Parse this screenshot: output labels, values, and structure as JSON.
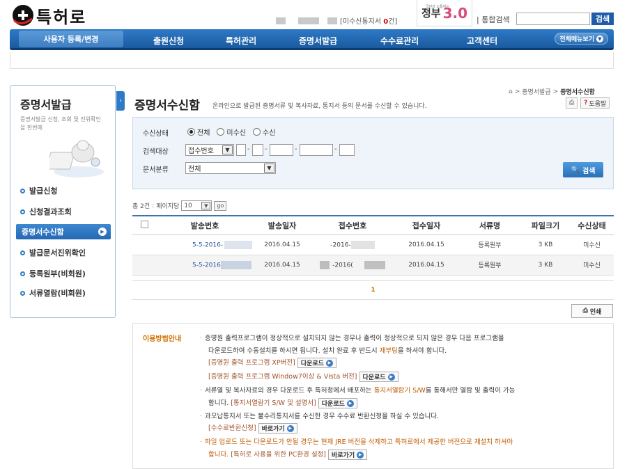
{
  "header": {
    "logo_text": "특허로",
    "unread_label_pre": "[미수신통지서 ",
    "unread_count": "0",
    "unread_label_post": "건]",
    "gov_brand": "정부",
    "gov_num": "3.0",
    "gov_small": "국민과 소통하는",
    "search_label": "| 통합검색",
    "search_button": "검색"
  },
  "gnb": {
    "first": "사용자 등록/변경",
    "items": [
      "출원신청",
      "특허관리",
      "증명서발급",
      "수수료관리",
      "고객센터"
    ],
    "all_menu": "전체메뉴보기"
  },
  "lnb": {
    "title": "증명서발급",
    "desc": "증명서발급 신청, 조회 및 진위확인을 한번에",
    "items": [
      "발급신청",
      "신청결과조회",
      "증명서수신함",
      "발급문서진위확인",
      "등록원부(비회원)",
      "서류열람(비회원)"
    ]
  },
  "content": {
    "title": "증명서수신함",
    "desc": "온라인으로 발급된 증명서류 및 복사자료, 통지서 등의 문서를 수신할 수 있습니다.",
    "breadcrumb_mid": "증명서발급",
    "breadcrumb_last": "증명서수신함",
    "help": "도움말"
  },
  "search": {
    "status_label": "수신상태",
    "status_options": [
      "전체",
      "미수신",
      "수신"
    ],
    "target_label": "검색대상",
    "target_value": "접수번호",
    "category_label": "문서분류",
    "category_value": "전체",
    "button": "검색"
  },
  "results": {
    "count_text": "총 2건",
    "per_page_label": "페이지당",
    "per_page": "10",
    "go": "go",
    "columns": [
      "발송번호",
      "발송일자",
      "접수번호",
      "접수일자",
      "서류명",
      "파일크기",
      "수신상태"
    ],
    "rows": [
      {
        "send_no": "5-5-2016-",
        "send_date": "2016.04.15",
        "recv_no": "-2016-",
        "recv_date": "2016.04.15",
        "doc": "등록원부",
        "size": "3 KB",
        "status": "미수신"
      },
      {
        "send_no": "5-5-2016",
        "send_date": "2016.04.15",
        "recv_no": "-2016(",
        "recv_date": "2016.04.15",
        "doc": "등록원부",
        "size": "3 KB",
        "status": "미수신"
      }
    ],
    "page": "1",
    "print": "인쇄"
  },
  "guide": {
    "title": "이용방법안내",
    "l1": "증명원 출력프로그램이 정상적으로 설치되지 않는 경우나 출력이 정상적으로 되지 않은 경우 다음 프로그램을",
    "l2a": "다운로드하여 수동설치를 하시면 됩니다. 설치 완료 후 반드시 ",
    "l2b": "재부팅",
    "l2c": "을 하셔야 합니다.",
    "l3": "[증명원 출력 프로그램 XP버전]",
    "l4": "[증명원 출력 프로그램 Window7이상 & Vista 버전]",
    "l5a": "서류열 및 복사자료의 경우 다운로드 후 특허청에서 배포하는 ",
    "l5b": "통지서열람기 S/W",
    "l5c": "를 통해서만 열람 및 출력이 가능",
    "l6a": "합니다. ",
    "l6b": "[통지서열람기 S/W 및 설명서]",
    "l7": "과오납통지서 또는 불수리통지서를 수신한 경우 수수료 반환신청을 하실 수 있습니다.",
    "l8": "[수수료반환신청]",
    "l9": "파일 업로드 또는 다운로드가 안될 경우는 현재 JRE 버전을 삭제하고 특허로에서 제공한 버전으로 재설치 하셔야",
    "l10a": "합니다. ",
    "l10b": "[특허로 사용을 위한 PC환경 설정]",
    "download": "다운로드",
    "goto": "바로가기"
  }
}
